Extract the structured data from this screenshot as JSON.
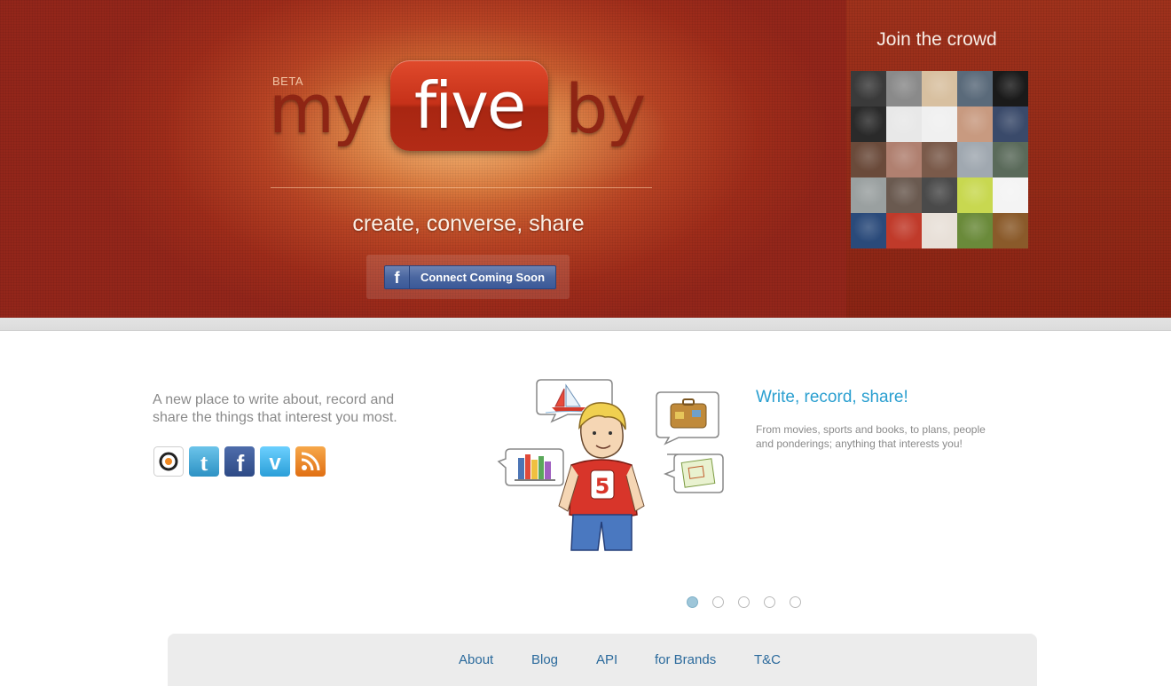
{
  "brand": {
    "beta_label": "BETA",
    "logo_part1": "my",
    "logo_part2": "five",
    "logo_part3": "by",
    "tagline": "create, converse, share"
  },
  "hero": {
    "connect_button": "Connect Coming Soon",
    "connect_icon": "f"
  },
  "crowd": {
    "title": "Join the crowd"
  },
  "intro": {
    "text": "A new place to write about, record and share the things that interest you most."
  },
  "social_links": [
    {
      "name": "orange-circle-icon",
      "color": "#f08a24"
    },
    {
      "name": "twitter-icon",
      "color": "#3fa9d6"
    },
    {
      "name": "facebook-icon",
      "color": "#3b5998"
    },
    {
      "name": "vimeo-icon",
      "color": "#44bbff"
    },
    {
      "name": "rss-icon",
      "color": "#f08a24"
    }
  ],
  "slide": {
    "heading": "Write, record, share!",
    "body": "From movies, sports and books, to plans, people and ponderings; anything that interests you!",
    "current": 1,
    "total": 5
  },
  "footer": {
    "links": [
      "About",
      "Blog",
      "API",
      "for Brands",
      "T&C"
    ]
  },
  "colors": {
    "brand_red": "#b53a20",
    "link_blue": "#2b6a9c",
    "heading_blue": "#2a9fd0"
  }
}
